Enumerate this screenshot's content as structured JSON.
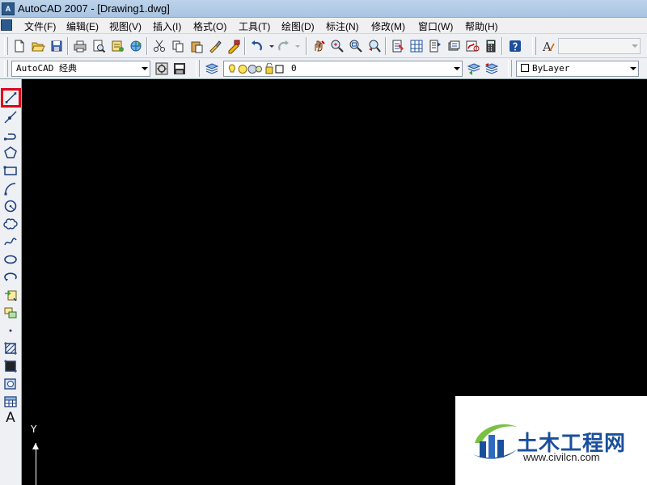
{
  "window": {
    "title": "AutoCAD 2007 - [Drawing1.dwg]",
    "app_icon_letter": "A"
  },
  "menu": {
    "items": [
      "文件(F)",
      "编辑(E)",
      "视图(V)",
      "插入(I)",
      "格式(O)",
      "工具(T)",
      "绘图(D)",
      "标注(N)",
      "修改(M)",
      "窗口(W)",
      "帮助(H)"
    ]
  },
  "toolbar_standard": {
    "buttons": [
      "new-icon",
      "open-icon",
      "save-icon",
      "plot-icon",
      "plot-preview-icon",
      "publish-icon",
      "3d-dwf-icon",
      "cut-icon",
      "copy-icon",
      "paste-icon",
      "match-properties-icon",
      "block-editor-icon",
      "undo-icon",
      "redo-icon",
      "pan-icon",
      "zoom-realtime-icon",
      "zoom-window-icon",
      "zoom-previous-icon",
      "properties-icon",
      "design-center-icon",
      "tool-palettes-icon",
      "sheet-set-icon",
      "markup-icon",
      "quickcalc-icon",
      "help-icon"
    ],
    "text_style_icon": "text-style-icon",
    "text_style_value": ""
  },
  "toolbar_workspace": {
    "workspace_value": "AutoCAD 经典",
    "layer_value": "0",
    "color_value": "ByLayer"
  },
  "draw_toolbar": {
    "tools": [
      "line-icon",
      "construction-line-icon",
      "polyline-icon",
      "polygon-icon",
      "rectangle-icon",
      "arc-icon",
      "circle-icon",
      "revision-cloud-icon",
      "spline-icon",
      "ellipse-icon",
      "ellipse-arc-icon",
      "insert-block-icon",
      "make-block-icon",
      "point-icon",
      "hatch-icon",
      "gradient-icon",
      "region-icon",
      "table-icon",
      "multiline-text-icon"
    ],
    "highlighted": "line-icon",
    "text_tool_label": "A"
  },
  "ucs": {
    "y_label": "Y"
  },
  "watermark": {
    "name": "土木工程网",
    "url": "www.civilcn.com"
  },
  "colors": {
    "canvas": "#000000",
    "highlight": "#e0001b",
    "watermark_blue": "#1a4f9c",
    "watermark_green": "#7ac142"
  }
}
